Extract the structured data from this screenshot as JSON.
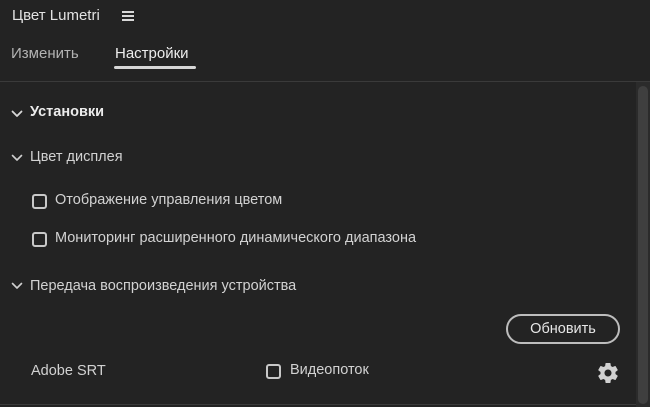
{
  "panel": {
    "title": "Цвет Lumetri",
    "menu_icon": "hamburger-icon"
  },
  "tabs": [
    {
      "label": "Изменить",
      "active": false
    },
    {
      "label": "Настройки",
      "active": true
    }
  ],
  "sections": {
    "presets": {
      "label": "Установки",
      "expanded": true
    },
    "display_color": {
      "label": "Цвет дисплея",
      "expanded": true,
      "options": [
        {
          "label": "Отображение управления цветом",
          "checked": false
        },
        {
          "label": "Мониторинг расширенного динамического диапазона",
          "checked": false
        }
      ]
    },
    "device_playback": {
      "label": "Передача воспроизведения устройства",
      "expanded": true,
      "refresh_label": "Обновить",
      "device_name": "Adobe SRT",
      "stream_label": "Видеопоток",
      "stream_checked": false,
      "settings_icon": "gear-icon"
    }
  },
  "colors": {
    "background": "#232323",
    "text": "#d2d2d2",
    "accent_underline": "#d6d6d6"
  }
}
